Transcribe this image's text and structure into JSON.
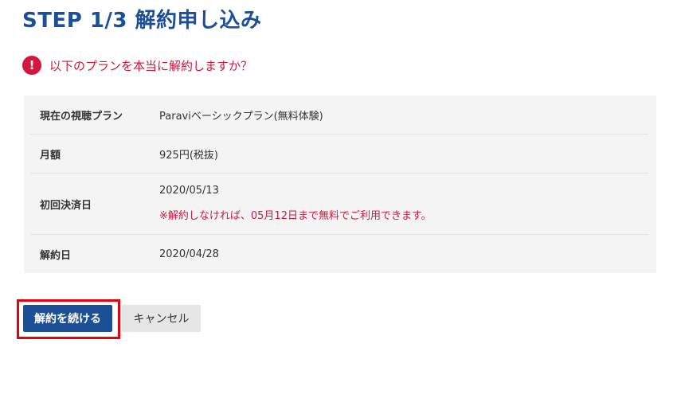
{
  "header": {
    "title": "STEP 1/3 解約申し込み"
  },
  "warning": {
    "icon": "exclamation-circle-icon",
    "text": "以下のプランを本当に解約しますか？",
    "color": "#d3173e"
  },
  "plan_details": {
    "rows": [
      {
        "label": "現在の視聴プラン",
        "value": "Paraviベーシックプラン(無料体験)"
      },
      {
        "label": "月額",
        "value": "925円(税抜)"
      },
      {
        "label": "初回決済日",
        "value": "2020/05/13",
        "note": "※解約しなければ、05月12日まで無料でご利用できます。"
      },
      {
        "label": "解約日",
        "value": "2020/04/28"
      }
    ]
  },
  "actions": {
    "continue_label": "解約を続ける",
    "cancel_label": "キャンセル",
    "accent_color": "#1d4f96",
    "highlight_color": "#e8000b"
  }
}
